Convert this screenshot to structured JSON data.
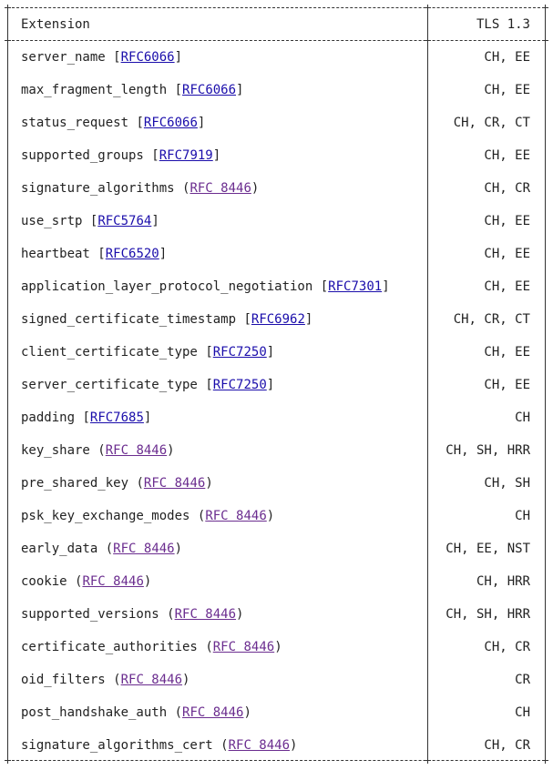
{
  "header": {
    "extension": "Extension",
    "tls": "TLS 1.3"
  },
  "rows": [
    {
      "name": "server_name",
      "open": "[",
      "ref": "RFC6066",
      "close": "]",
      "kind": "blue",
      "tls": "CH, EE"
    },
    {
      "name": "max_fragment_length",
      "open": "[",
      "ref": "RFC6066",
      "close": "]",
      "kind": "blue",
      "tls": "CH, EE"
    },
    {
      "name": "status_request",
      "open": "[",
      "ref": "RFC6066",
      "close": "]",
      "kind": "blue",
      "tls": "CH, CR, CT"
    },
    {
      "name": "supported_groups",
      "open": "[",
      "ref": "RFC7919",
      "close": "]",
      "kind": "blue",
      "tls": "CH, EE"
    },
    {
      "name": "signature_algorithms",
      "open": "(",
      "ref": "RFC 8446",
      "close": ")",
      "kind": "purple",
      "tls": "CH, CR"
    },
    {
      "name": "use_srtp",
      "open": "[",
      "ref": "RFC5764",
      "close": "]",
      "kind": "blue",
      "tls": "CH, EE"
    },
    {
      "name": "heartbeat",
      "open": "[",
      "ref": "RFC6520",
      "close": "]",
      "kind": "blue",
      "tls": "CH, EE"
    },
    {
      "name": "application_layer_protocol_negotiation",
      "open": "[",
      "ref": "RFC7301",
      "close": "]",
      "kind": "blue",
      "tls": "CH, EE"
    },
    {
      "name": "signed_certificate_timestamp",
      "open": "[",
      "ref": "RFC6962",
      "close": "]",
      "kind": "blue",
      "tls": "CH, CR, CT"
    },
    {
      "name": "client_certificate_type",
      "open": "[",
      "ref": "RFC7250",
      "close": "]",
      "kind": "blue",
      "tls": "CH, EE"
    },
    {
      "name": "server_certificate_type",
      "open": "[",
      "ref": "RFC7250",
      "close": "]",
      "kind": "blue",
      "tls": "CH, EE"
    },
    {
      "name": "padding",
      "open": "[",
      "ref": "RFC7685",
      "close": "]",
      "kind": "blue",
      "tls": "CH"
    },
    {
      "name": "key_share",
      "open": "(",
      "ref": "RFC 8446",
      "close": ")",
      "kind": "purple",
      "tls": "CH, SH, HRR"
    },
    {
      "name": "pre_shared_key",
      "open": "(",
      "ref": "RFC 8446",
      "close": ")",
      "kind": "purple",
      "tls": "CH, SH"
    },
    {
      "name": "psk_key_exchange_modes",
      "open": "(",
      "ref": "RFC 8446",
      "close": ")",
      "kind": "purple",
      "tls": "CH"
    },
    {
      "name": "early_data",
      "open": "(",
      "ref": "RFC 8446",
      "close": ")",
      "kind": "purple",
      "tls": "CH, EE, NST"
    },
    {
      "name": "cookie",
      "open": "(",
      "ref": "RFC 8446",
      "close": ")",
      "kind": "purple",
      "tls": "CH, HRR"
    },
    {
      "name": "supported_versions",
      "open": "(",
      "ref": "RFC 8446",
      "close": ")",
      "kind": "purple",
      "tls": "CH, SH, HRR"
    },
    {
      "name": "certificate_authorities",
      "open": "(",
      "ref": "RFC 8446",
      "close": ")",
      "kind": "purple",
      "tls": "CH, CR"
    },
    {
      "name": "oid_filters",
      "open": "(",
      "ref": "RFC 8446",
      "close": ")",
      "kind": "purple",
      "tls": "CR"
    },
    {
      "name": "post_handshake_auth",
      "open": "(",
      "ref": "RFC 8446",
      "close": ")",
      "kind": "purple",
      "tls": "CH"
    },
    {
      "name": "signature_algorithms_cert",
      "open": "(",
      "ref": "RFC 8446",
      "close": ")",
      "kind": "purple",
      "tls": "CH, CR"
    }
  ],
  "colors": {
    "link_unvisited": "#1a0dab",
    "link_visited": "#6b2d8f",
    "border": "#333333"
  }
}
